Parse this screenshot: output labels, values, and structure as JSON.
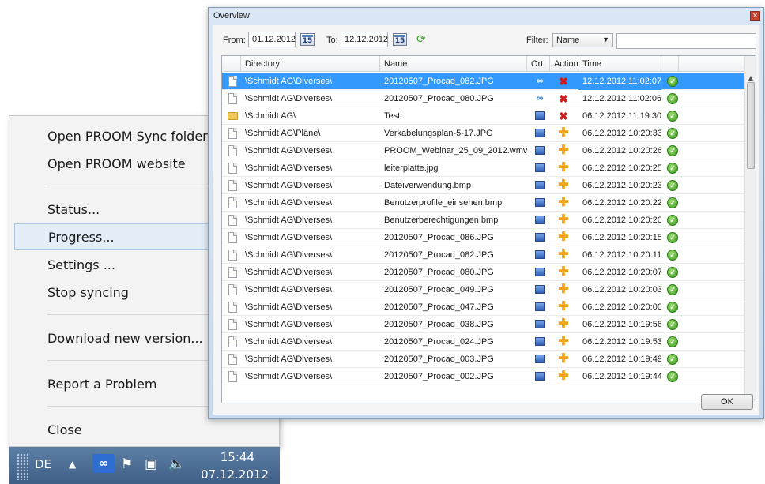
{
  "context_menu": {
    "items": [
      {
        "label": "Open PROOM Sync folder"
      },
      {
        "label": "Open PROOM website"
      },
      {
        "label": "Status..."
      },
      {
        "label": "Progress..."
      },
      {
        "label": "Settings ..."
      },
      {
        "label": "Stop syncing"
      },
      {
        "label": "Download new version..."
      },
      {
        "label": "Report a Problem"
      },
      {
        "label": "Close"
      }
    ]
  },
  "taskbar": {
    "language": "DE",
    "time": "15:44",
    "date": "07.12.2012"
  },
  "dialog": {
    "title": "Overview",
    "close_glyph": "×",
    "from_label": "From:",
    "from_value": "01.12.2012",
    "to_label": "To:",
    "to_value": "12.12.2012",
    "calendar_glyph": "15",
    "filter_label": "Filter:",
    "filter_selected": "Name",
    "filter_value": "",
    "ok_label": "OK",
    "columns": {
      "directory": "Directory",
      "name": "Name",
      "ort": "Ort",
      "action": "Action",
      "time": "Time"
    },
    "rows": [
      {
        "icon": "doc",
        "directory": "\\Schmidt AG\\Diverses\\",
        "name": "20120507_Procad_082.JPG",
        "ort": "cloud",
        "action": "x",
        "time": "12.12.2012 11:02:07",
        "selected": true
      },
      {
        "icon": "doc",
        "directory": "\\Schmidt AG\\Diverses\\",
        "name": "20120507_Procad_080.JPG",
        "ort": "cloud",
        "action": "x",
        "time": "12.12.2012 11:02:06"
      },
      {
        "icon": "folder",
        "directory": "\\Schmidt AG\\",
        "name": "Test",
        "ort": "monitor",
        "action": "x",
        "time": "06.12.2012 11:19:30"
      },
      {
        "icon": "doc",
        "directory": "\\Schmidt AG\\Pläne\\",
        "name": "Verkabelungsplan-5-17.JPG",
        "ort": "monitor",
        "action": "plus",
        "time": "06.12.2012 10:20:33"
      },
      {
        "icon": "doc",
        "directory": "\\Schmidt AG\\Diverses\\",
        "name": "PROOM_Webinar_25_09_2012.wmv",
        "ort": "monitor",
        "action": "plus",
        "time": "06.12.2012 10:20:26"
      },
      {
        "icon": "doc",
        "directory": "\\Schmidt AG\\Diverses\\",
        "name": "leiterplatte.jpg",
        "ort": "monitor",
        "action": "plus",
        "time": "06.12.2012 10:20:25"
      },
      {
        "icon": "doc",
        "directory": "\\Schmidt AG\\Diverses\\",
        "name": "Dateiverwendung.bmp",
        "ort": "monitor",
        "action": "plus",
        "time": "06.12.2012 10:20:23"
      },
      {
        "icon": "doc",
        "directory": "\\Schmidt AG\\Diverses\\",
        "name": "Benutzerprofile_einsehen.bmp",
        "ort": "monitor",
        "action": "plus",
        "time": "06.12.2012 10:20:22"
      },
      {
        "icon": "doc",
        "directory": "\\Schmidt AG\\Diverses\\",
        "name": "Benutzerberechtigungen.bmp",
        "ort": "monitor",
        "action": "plus",
        "time": "06.12.2012 10:20:20"
      },
      {
        "icon": "doc",
        "directory": "\\Schmidt AG\\Diverses\\",
        "name": "20120507_Procad_086.JPG",
        "ort": "monitor",
        "action": "plus",
        "time": "06.12.2012 10:20:15"
      },
      {
        "icon": "doc",
        "directory": "\\Schmidt AG\\Diverses\\",
        "name": "20120507_Procad_082.JPG",
        "ort": "monitor",
        "action": "plus",
        "time": "06.12.2012 10:20:11"
      },
      {
        "icon": "doc",
        "directory": "\\Schmidt AG\\Diverses\\",
        "name": "20120507_Procad_080.JPG",
        "ort": "monitor",
        "action": "plus",
        "time": "06.12.2012 10:20:07"
      },
      {
        "icon": "doc",
        "directory": "\\Schmidt AG\\Diverses\\",
        "name": "20120507_Procad_049.JPG",
        "ort": "monitor",
        "action": "plus",
        "time": "06.12.2012 10:20:03"
      },
      {
        "icon": "doc",
        "directory": "\\Schmidt AG\\Diverses\\",
        "name": "20120507_Procad_047.JPG",
        "ort": "monitor",
        "action": "plus",
        "time": "06.12.2012 10:20:00"
      },
      {
        "icon": "doc",
        "directory": "\\Schmidt AG\\Diverses\\",
        "name": "20120507_Procad_038.JPG",
        "ort": "monitor",
        "action": "plus",
        "time": "06.12.2012 10:19:56"
      },
      {
        "icon": "doc",
        "directory": "\\Schmidt AG\\Diverses\\",
        "name": "20120507_Procad_024.JPG",
        "ort": "monitor",
        "action": "plus",
        "time": "06.12.2012 10:19:53"
      },
      {
        "icon": "doc",
        "directory": "\\Schmidt AG\\Diverses\\",
        "name": "20120507_Procad_003.JPG",
        "ort": "monitor",
        "action": "plus",
        "time": "06.12.2012 10:19:49"
      },
      {
        "icon": "doc",
        "directory": "\\Schmidt AG\\Diverses\\",
        "name": "20120507_Procad_002.JPG",
        "ort": "monitor",
        "action": "plus",
        "time": "06.12.2012 10:19:44"
      }
    ]
  },
  "colors": {
    "selection": "#3399ff",
    "dialog_frame": "#c8d9ee",
    "taskbar": "#4a6b93",
    "menu_highlight": "#e4eef9"
  }
}
